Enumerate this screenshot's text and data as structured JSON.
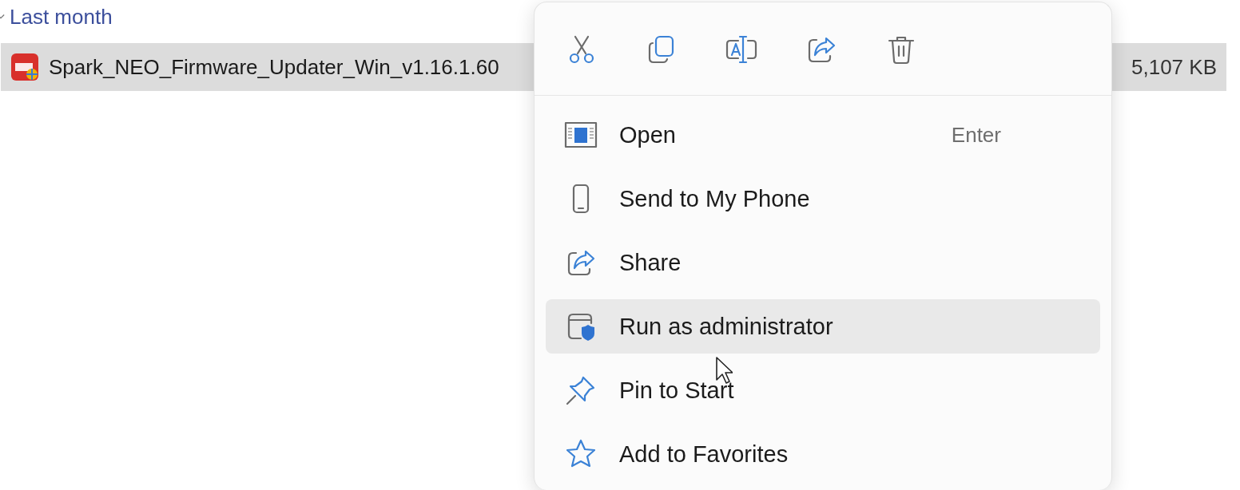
{
  "group": {
    "label": "Last month",
    "expanded": true
  },
  "files": [
    {
      "name": "Spark_NEO_Firmware_Updater_Win_v1.16.1.60",
      "size": "5,107 KB",
      "selected": true
    }
  ],
  "context_menu": {
    "toolbar": [
      {
        "kind": "cut"
      },
      {
        "kind": "copy"
      },
      {
        "kind": "rename"
      },
      {
        "kind": "share"
      },
      {
        "kind": "delete"
      }
    ],
    "items": [
      {
        "kind": "open",
        "label": "Open",
        "shortcut": "Enter",
        "highlighted": false
      },
      {
        "kind": "phone",
        "label": "Send to My Phone",
        "highlighted": false
      },
      {
        "kind": "share",
        "label": "Share",
        "highlighted": false
      },
      {
        "kind": "admin",
        "label": "Run as administrator",
        "highlighted": true
      },
      {
        "kind": "pin",
        "label": "Pin to Start",
        "highlighted": false
      },
      {
        "kind": "favorite",
        "label": "Add to Favorites",
        "highlighted": false
      }
    ]
  }
}
